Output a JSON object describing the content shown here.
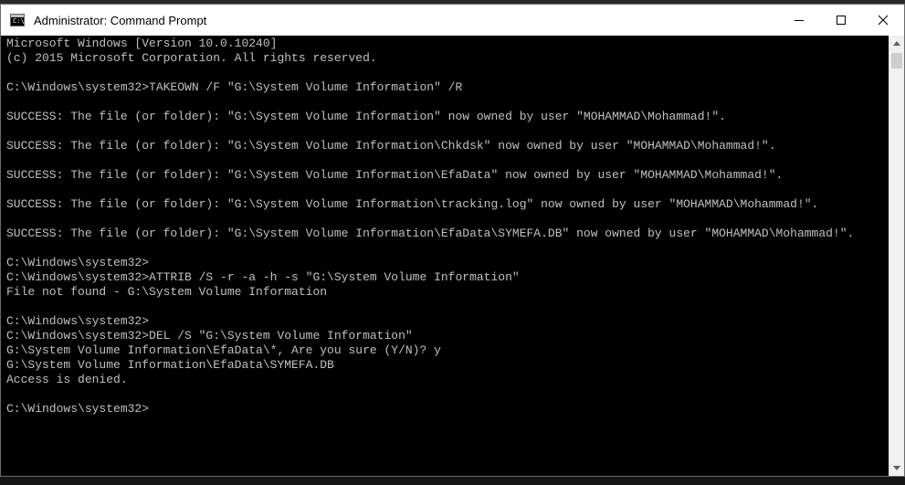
{
  "window": {
    "title": "Administrator: Command Prompt",
    "icon_glyph": "C:\\",
    "icons": {
      "app": "cmd-icon",
      "minimize": "minimize-icon",
      "maximize": "maximize-icon",
      "close": "close-icon"
    }
  },
  "console": {
    "text_color": "#c0c0c0",
    "background": "#000000",
    "lines": [
      "Microsoft Windows [Version 10.0.10240]",
      "(c) 2015 Microsoft Corporation. All rights reserved.",
      "",
      "C:\\Windows\\system32>TAKEOWN /F \"G:\\System Volume Information\" /R",
      "",
      "SUCCESS: The file (or folder): \"G:\\System Volume Information\" now owned by user \"MOHAMMAD\\Mohammad!\".",
      "",
      "SUCCESS: The file (or folder): \"G:\\System Volume Information\\Chkdsk\" now owned by user \"MOHAMMAD\\Mohammad!\".",
      "",
      "SUCCESS: The file (or folder): \"G:\\System Volume Information\\EfaData\" now owned by user \"MOHAMMAD\\Mohammad!\".",
      "",
      "SUCCESS: The file (or folder): \"G:\\System Volume Information\\tracking.log\" now owned by user \"MOHAMMAD\\Mohammad!\".",
      "",
      "SUCCESS: The file (or folder): \"G:\\System Volume Information\\EfaData\\SYMEFA.DB\" now owned by user \"MOHAMMAD\\Mohammad!\".",
      "",
      "C:\\Windows\\system32>",
      "C:\\Windows\\system32>ATTRIB /S -r -a -h -s \"G:\\System Volume Information\"",
      "File not found - G:\\System Volume Information",
      "",
      "C:\\Windows\\system32>",
      "C:\\Windows\\system32>DEL /S \"G:\\System Volume Information\"",
      "G:\\System Volume Information\\EfaData\\*, Are you sure (Y/N)? y",
      "G:\\System Volume Information\\EfaData\\SYMEFA.DB",
      "Access is denied.",
      "",
      "C:\\Windows\\system32>"
    ]
  },
  "scrollbar": {
    "up_icon": "scroll-up-arrow-icon",
    "down_icon": "scroll-down-arrow-icon"
  }
}
